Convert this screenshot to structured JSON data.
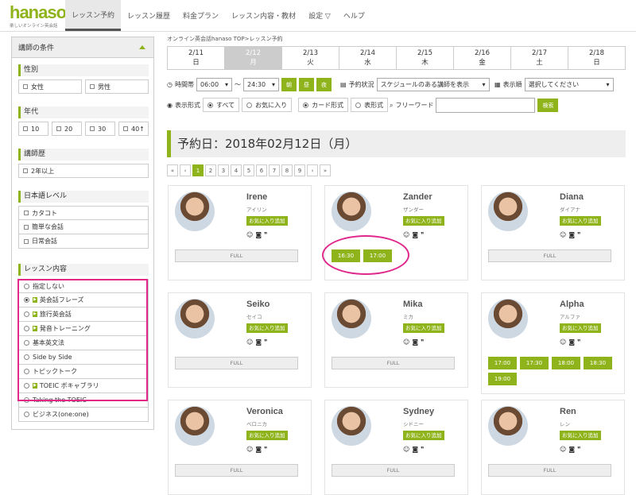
{
  "header": {
    "logo": "hanaso",
    "logo_sub": "楽しいオンライン英会話",
    "nav": [
      "レッスン予約",
      "レッスン履歴",
      "料金プラン",
      "レッスン内容・教材",
      "設定 ▽",
      "ヘルプ"
    ]
  },
  "sidebar": {
    "title": "講師の条件",
    "gender": {
      "label": "性別",
      "options": [
        "女性",
        "男性"
      ]
    },
    "age": {
      "label": "年代",
      "options": [
        "10",
        "20",
        "30",
        "40↑"
      ]
    },
    "experience": {
      "label": "講師歴",
      "options": [
        "2年以上"
      ]
    },
    "japanese": {
      "label": "日本語レベル",
      "options": [
        "カタコト",
        "簡単な会話",
        "日常会話"
      ]
    },
    "lesson": {
      "label": "レッスン内容",
      "options": [
        {
          "label": "指定しない",
          "tag": false,
          "selected": false
        },
        {
          "label": "英会話フレーズ",
          "tag": true,
          "selected": true
        },
        {
          "label": "旅行英会話",
          "tag": true,
          "selected": false
        },
        {
          "label": "発音トレーニング",
          "tag": true,
          "selected": false
        },
        {
          "label": "基本英文法",
          "tag": false,
          "selected": false
        },
        {
          "label": "Side by Side",
          "tag": false,
          "selected": false
        },
        {
          "label": "トピックトーク",
          "tag": false,
          "selected": false
        },
        {
          "label": "TOEIC ボキャブラリ",
          "tag": true,
          "selected": false
        },
        {
          "label": "Taking the TOEIC",
          "tag": false,
          "selected": false
        },
        {
          "label": "ビジネス(one:one)",
          "tag": false,
          "selected": false
        }
      ]
    }
  },
  "main": {
    "breadcrumb": "オンライン英会話hanaso TOP>レッスン予約",
    "dates": [
      {
        "date": "2/11",
        "day": "日",
        "selected": false
      },
      {
        "date": "2/12",
        "day": "月",
        "selected": true
      },
      {
        "date": "2/13",
        "day": "火",
        "selected": false
      },
      {
        "date": "2/14",
        "day": "水",
        "selected": false
      },
      {
        "date": "2/15",
        "day": "木",
        "selected": false
      },
      {
        "date": "2/16",
        "day": "金",
        "selected": false
      },
      {
        "date": "2/17",
        "day": "土",
        "selected": false
      },
      {
        "date": "2/18",
        "day": "日",
        "selected": false
      }
    ],
    "time_label": "時間帯",
    "time_from": "06:00",
    "time_to": "24:30",
    "time_sep": "～",
    "time_buttons": [
      "朝",
      "昼",
      "夜"
    ],
    "status_label": "予約状況",
    "status_value": "スケジュールのある講師を表示",
    "order_label": "表示順",
    "order_value": "選択してください",
    "display_label": "表示形式",
    "display_opts": [
      "すべて",
      "お気に入り"
    ],
    "format_opts": [
      "カード形式",
      "表形式"
    ],
    "free_label": "フリーワード",
    "search_btn": "検索",
    "page_title": "予約日：2018年02月12日（月）",
    "pagination": [
      "«",
      "‹",
      "1",
      "2",
      "3",
      "4",
      "5",
      "6",
      "7",
      "8",
      "9",
      "›",
      "»"
    ],
    "fav_label": "お気に入り追加",
    "full_label": "FULL",
    "teachers": [
      {
        "name": "Irene",
        "kana": "アイリン",
        "slots": []
      },
      {
        "name": "Zander",
        "kana": "ザンダー",
        "slots": [
          "16:30",
          "17:00"
        ]
      },
      {
        "name": "Diana",
        "kana": "ダイアナ",
        "slots": []
      },
      {
        "name": "Seiko",
        "kana": "セイコ",
        "slots": []
      },
      {
        "name": "Mika",
        "kana": "ミカ",
        "slots": []
      },
      {
        "name": "Alpha",
        "kana": "アルファ",
        "slots": [
          "17:00",
          "17:30",
          "18:00",
          "18:30",
          "19:00"
        ]
      },
      {
        "name": "Veronica",
        "kana": "ベロニカ",
        "slots": []
      },
      {
        "name": "Sydney",
        "kana": "シドニー",
        "slots": []
      },
      {
        "name": "Ren",
        "kana": "レン",
        "slots": []
      }
    ]
  },
  "colors": {
    "accent": "#8fb31a",
    "highlight": "#e0288c"
  }
}
